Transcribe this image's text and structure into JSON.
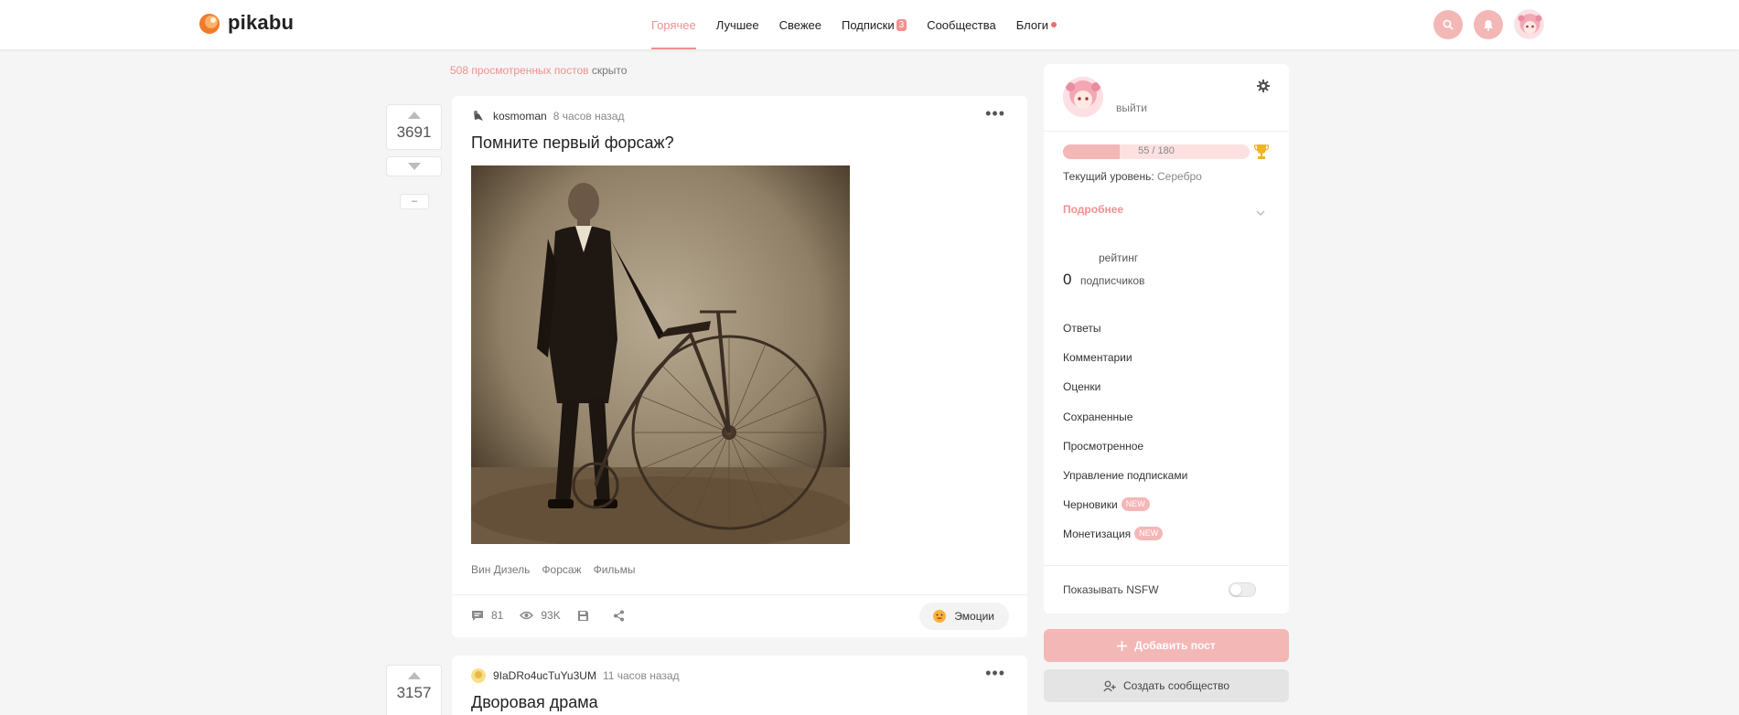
{
  "header": {
    "logo_text": "pikabu",
    "nav": [
      {
        "label": "Горячее",
        "active": true
      },
      {
        "label": "Лучшее"
      },
      {
        "label": "Свежее"
      },
      {
        "label": "Подписки",
        "badge": "3"
      },
      {
        "label": "Сообщества"
      },
      {
        "label": "Блоги",
        "dot": true
      }
    ],
    "icons": [
      "search-icon",
      "bell-icon",
      "avatar"
    ]
  },
  "viewed_note": {
    "count_text": "508 просмотренных постов",
    "suffix": "скрыто"
  },
  "posts": [
    {
      "rating": "3691",
      "author": "kosmoman",
      "time": "8 часов назад",
      "title": "Помните первый форсаж?",
      "tags": [
        "Вин Дизель",
        "Форсаж",
        "Фильмы"
      ],
      "comments": "81",
      "views": "93K",
      "emotions_label": "Эмоции",
      "minus_label": "–"
    },
    {
      "rating": "3157",
      "author": "9IaDRo4ucTuYu3UM",
      "time": "11 часов назад",
      "title": "Дворовая драма"
    }
  ],
  "sidebar": {
    "logout": "выйти",
    "progress": {
      "text": "55 / 180",
      "current": 55,
      "max": 180
    },
    "level_label": "Текущий уровень:",
    "level_value": "Серебро",
    "more": "Подробнее",
    "rating_label": "рейтинг",
    "subscribers_count": "0",
    "subscribers_label": "подписчиков",
    "menu": [
      {
        "label": "Ответы"
      },
      {
        "label": "Комментарии"
      },
      {
        "label": "Оценки"
      },
      {
        "label": "Сохраненные"
      },
      {
        "label": "Просмотренное"
      },
      {
        "label": "Управление подписками"
      },
      {
        "label": "Черновики",
        "badge": "NEW"
      },
      {
        "label": "Монетизация",
        "badge": "NEW"
      }
    ],
    "nsfw_label": "Показывать NSFW",
    "nsfw_enabled": false,
    "add_post": "Добавить пост",
    "create_community": "Создать сообщество"
  },
  "colors": {
    "accent": "#f0918f",
    "accent_light": "#f3b7b6",
    "background": "#f5f5f5"
  }
}
